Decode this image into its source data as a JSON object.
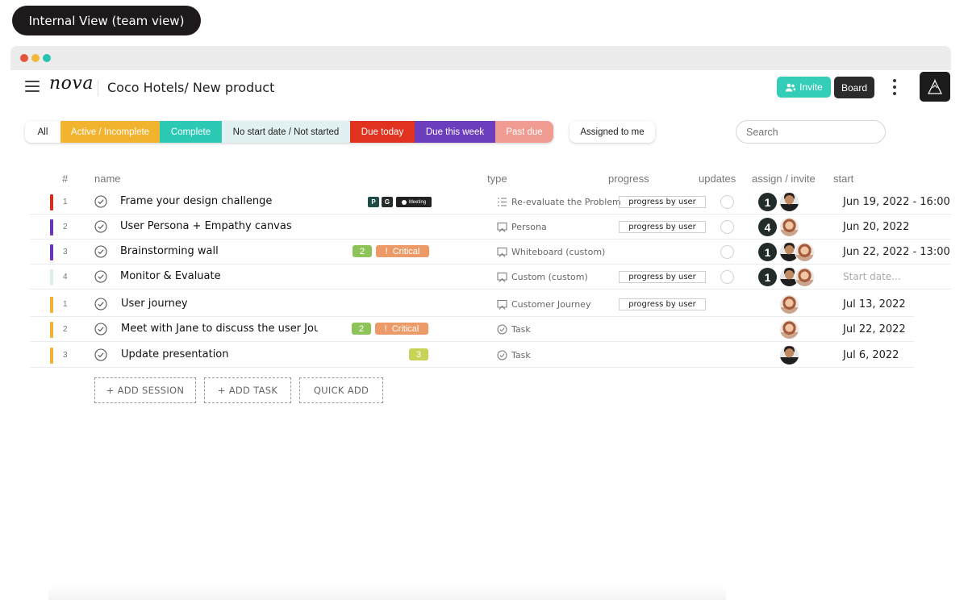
{
  "label_pill": "Internal View (team view)",
  "header": {
    "logo": "nova",
    "breadcrumb": "Coco Hotels/ New product",
    "invite_label": "Invite",
    "board_label": "Board"
  },
  "filters": [
    {
      "label": "All",
      "bg": "#ffffff",
      "fg": "#222222"
    },
    {
      "label": "Active / Incomplete",
      "bg": "#f2b32f",
      "fg": "#ffffff"
    },
    {
      "label": "Complete",
      "bg": "#2cc9b4",
      "fg": "#ffffff"
    },
    {
      "label": "No start date / Not started",
      "bg": "#e1f1f1",
      "fg": "#222222"
    },
    {
      "label": "Due today",
      "bg": "#e0321e",
      "fg": "#ffffff"
    },
    {
      "label": "Due this week",
      "bg": "#6c3dbd",
      "fg": "#ffffff"
    },
    {
      "label": "Past due",
      "bg": "#f19c93",
      "fg": "#ffffff"
    }
  ],
  "assigned_label": "Assigned to me",
  "search": {
    "placeholder": "Search"
  },
  "columns": {
    "num": "#",
    "name": "name",
    "type": "type",
    "progress": "progress",
    "updates": "updates",
    "assign": "assign / invite",
    "start": "start"
  },
  "tags": {
    "p": "P",
    "g": "G",
    "meeting": "Meeting",
    "critical": "Critical"
  },
  "rows": [
    {
      "num": "1",
      "name": "Frame your design challenge",
      "bar_color": "#dc2c1f",
      "type": "Re-evaluate the Problem",
      "type_icon": "list-icon",
      "progress": "progress by user",
      "count": "1",
      "start": "Jun 19, 2022 - 16:00"
    },
    {
      "num": "2",
      "name": "User Persona + Empathy canvas",
      "bar_color": "#6a35b8",
      "type": "Persona",
      "type_icon": "canvas-icon",
      "progress": "progress by user",
      "count": "4",
      "start": "Jun 20, 2022"
    },
    {
      "num": "3",
      "name": "Brainstorming wall",
      "bar_color": "#6a35b8",
      "type": "Whiteboard (custom)",
      "type_icon": "canvas-icon",
      "chip_count": "2",
      "count": "1",
      "start": "Jun 22, 2022 - 13:00"
    },
    {
      "num": "4",
      "name": "Monitor & Evaluate",
      "bar_color": "#dceeee",
      "type": "Custom (custom)",
      "type_icon": "canvas-icon",
      "progress": "progress by user",
      "count": "1",
      "start": "Start date..."
    },
    {
      "num": "1",
      "name": "User journey",
      "bar_color": "#f2b32f",
      "type": "Customer Journey",
      "type_icon": "canvas-icon",
      "progress": "progress by user",
      "start": "Jul 13, 2022"
    },
    {
      "num": "2",
      "name": "Meet with Jane to discuss the user Journey",
      "bar_color": "#f2b32f",
      "type": "Task",
      "type_icon": "task-check-icon",
      "chip_count": "2",
      "start": "Jul 22, 2022"
    },
    {
      "num": "3",
      "name": "Update presentation",
      "bar_color": "#f2b32f",
      "type": "Task",
      "type_icon": "task-check-icon",
      "chip_count": "3",
      "start": "Jul 6, 2022"
    }
  ],
  "actions": {
    "add_session": "+ ADD SESSION",
    "add_task": "+ ADD TASK",
    "quick_add": "QUICK ADD"
  }
}
